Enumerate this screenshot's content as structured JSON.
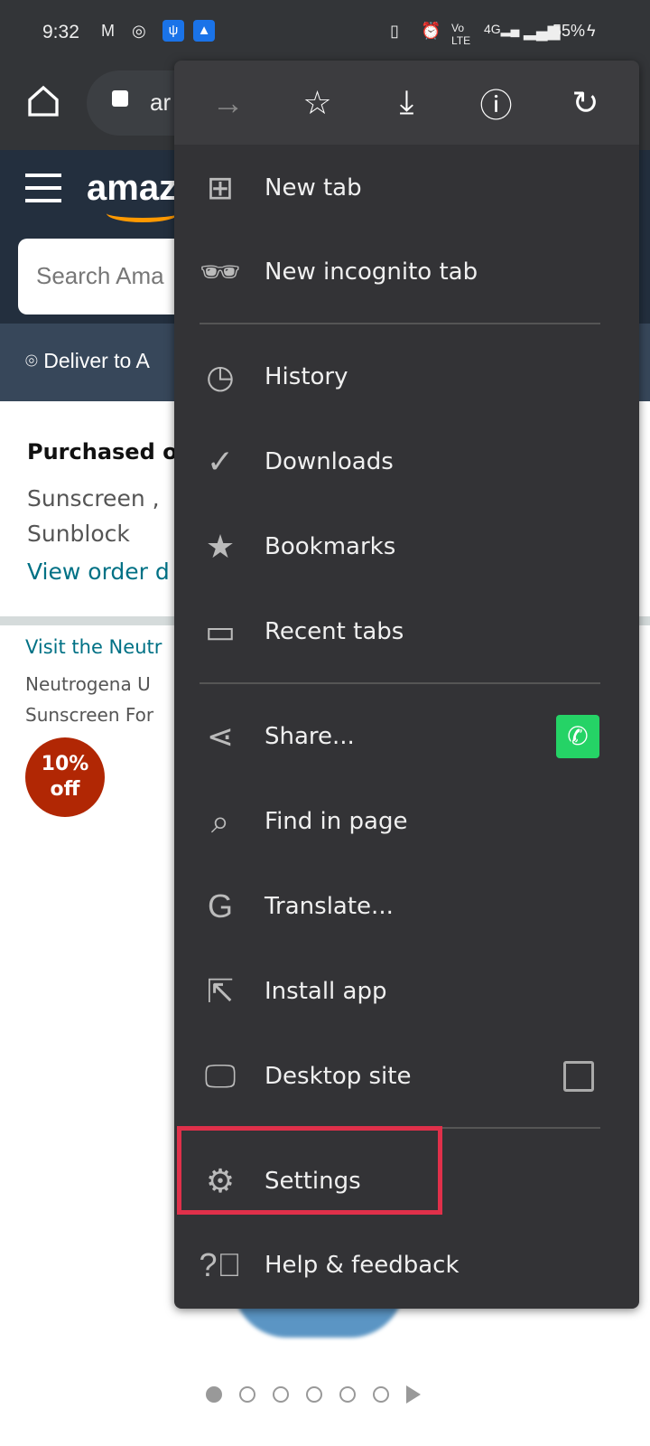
{
  "status_bar": {
    "time": "9:32",
    "battery": "55%",
    "icons": [
      "gmail-icon",
      "instagram-icon",
      "usb-icon",
      "android-icon",
      "vibrate-icon",
      "alarm-icon",
      "volte-icon",
      "4g-signal-icon",
      "signal-icon",
      "charging-icon"
    ]
  },
  "browser": {
    "url_partial": "ar"
  },
  "amazon": {
    "logo": "amaz",
    "search_placeholder": "Search Ama",
    "deliver": "Deliver to A",
    "purchased": "Purchased o",
    "product_line1": "Sunscreen ,",
    "product_line2": "Sunblock",
    "view_order": "View order d",
    "visit": "Visit the Neutr",
    "title_line1": "Neutrogena U",
    "title_line2": "Sunscreen For",
    "badge_pct": "10%",
    "badge_off": "off",
    "carousel": {
      "pages": 6,
      "active": 1
    }
  },
  "menu": {
    "toolbar": [
      "forward-icon",
      "bookmark-star-icon",
      "download-icon",
      "info-icon",
      "refresh-icon"
    ],
    "items": [
      {
        "label": "New tab",
        "icon": "new-tab-icon"
      },
      {
        "label": "New incognito tab",
        "icon": "incognito-icon"
      },
      {
        "label": "History",
        "icon": "history-icon"
      },
      {
        "label": "Downloads",
        "icon": "downloads-icon"
      },
      {
        "label": "Bookmarks",
        "icon": "star-icon"
      },
      {
        "label": "Recent tabs",
        "icon": "devices-icon"
      },
      {
        "label": "Share...",
        "icon": "share-icon"
      },
      {
        "label": "Find in page",
        "icon": "find-icon"
      },
      {
        "label": "Translate...",
        "icon": "translate-icon"
      },
      {
        "label": "Install app",
        "icon": "install-icon"
      },
      {
        "label": "Desktop site",
        "icon": "desktop-icon",
        "checked": false
      },
      {
        "label": "Settings",
        "icon": "gear-icon",
        "highlighted": true
      },
      {
        "label": "Help & feedback",
        "icon": "help-icon"
      }
    ],
    "highlight_color": "#e0304a"
  }
}
